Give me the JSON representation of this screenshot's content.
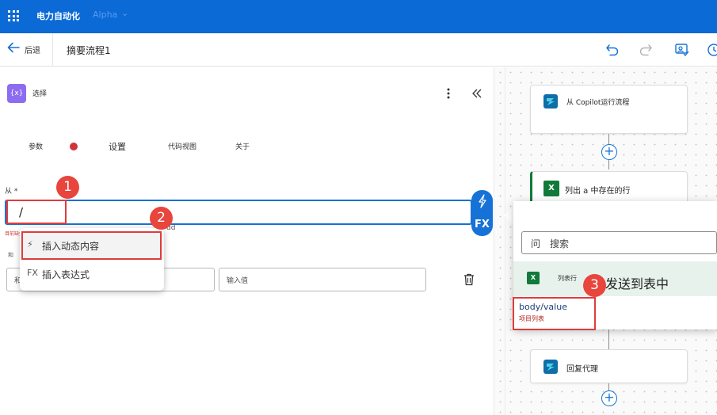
{
  "header": {
    "app_title": "电力自动化",
    "environment": "Alpha"
  },
  "commandbar": {
    "back_label": "后退",
    "flow_name": "摘要流程1"
  },
  "action_panel": {
    "action_title": "选择",
    "action_icon_text": "{x}",
    "tabs": [
      {
        "label": "参数"
      },
      {
        "label": "设置"
      },
      {
        "label": "代码视图"
      },
      {
        "label": "关于"
      }
    ],
    "from_label": "从 *",
    "from_value": "/",
    "error_text": "目前缺失",
    "peek_text": "dd",
    "and_label": "和",
    "condition_left_placeholder": "和",
    "condition_right_placeholder": "输入值"
  },
  "insert_menu": {
    "items": [
      {
        "icon": "⚡",
        "label": "插入动态内容"
      },
      {
        "icon": "FX",
        "label": "插入表达式"
      }
    ]
  },
  "rail": {
    "fx_label": "FX"
  },
  "canvas": {
    "cards": [
      {
        "label": "从 Copilot运行流程"
      },
      {
        "label": "列出 a 中存在的行"
      },
      {
        "label": "回复代理"
      }
    ]
  },
  "dynamic_content": {
    "search_icon": "问",
    "search_label": "搜索",
    "group_small_label": "列表行",
    "group_big_label": "发送到表中",
    "token_name": "body/value",
    "token_type": "项目列表"
  },
  "callouts": [
    "1",
    "2",
    "3"
  ],
  "colors": {
    "brand": "#0b6ad6",
    "accent": "#1672d6",
    "error": "#d13438",
    "callout": "#e8453c",
    "excel": "#117a3a"
  }
}
